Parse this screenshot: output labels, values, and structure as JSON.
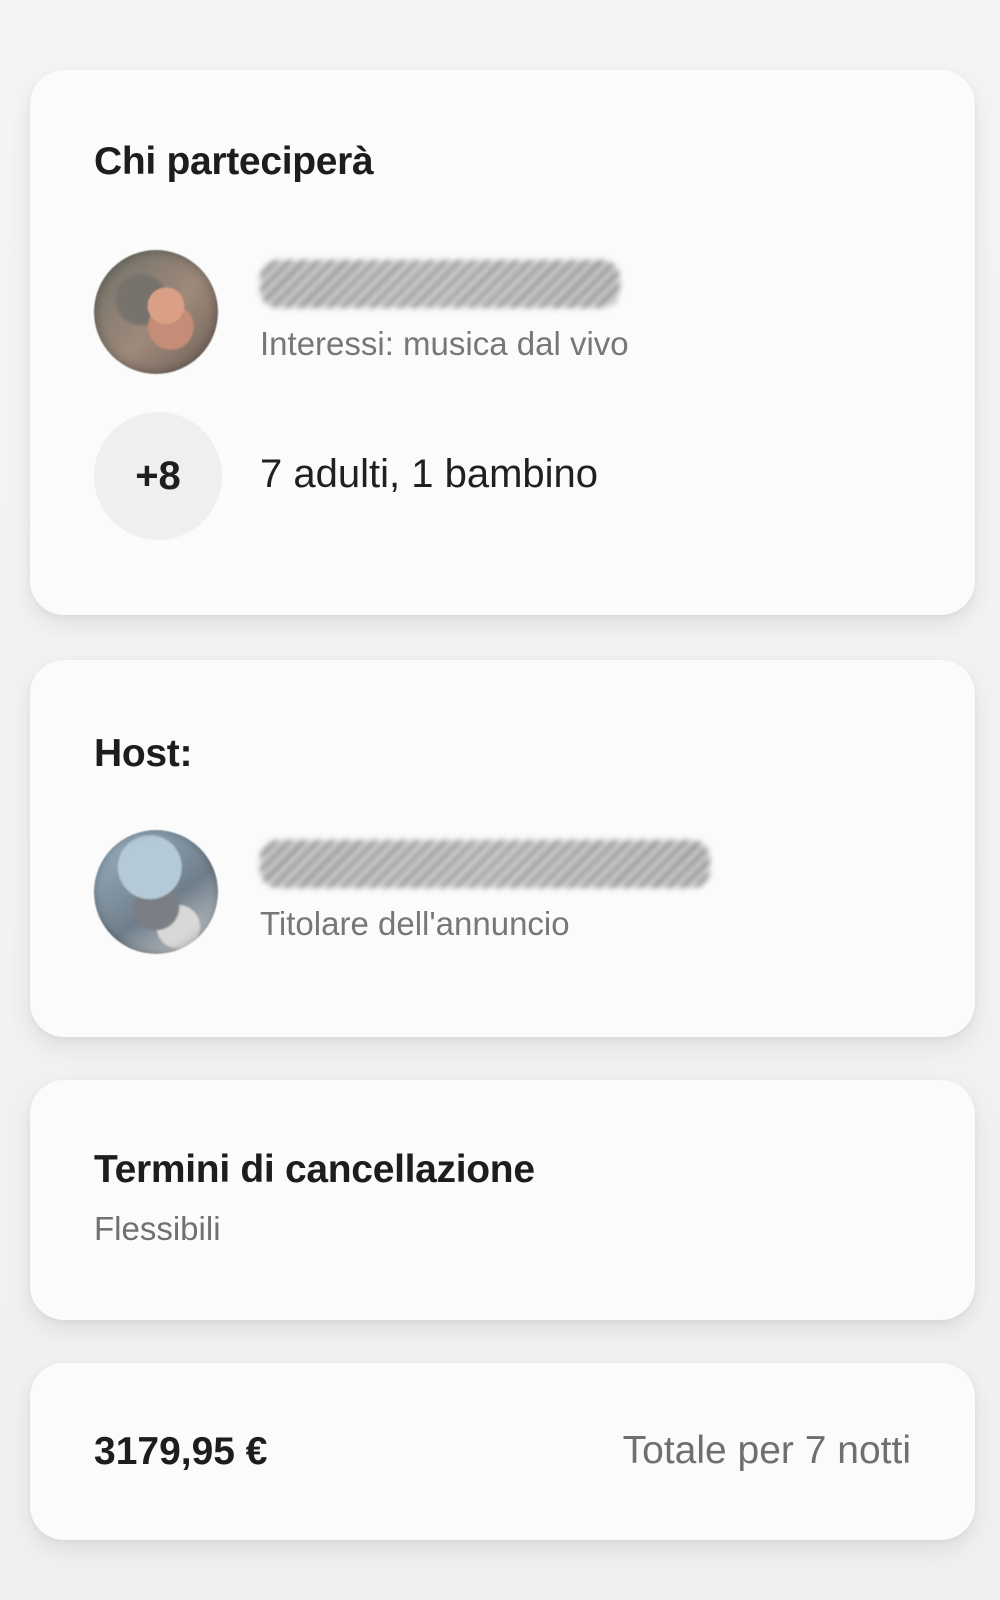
{
  "guests": {
    "title": "Chi parteciperà",
    "guest_interest": "Interessi: musica dal vivo",
    "additional_count": "+8",
    "additional_summary": "7 adulti, 1 bambino"
  },
  "host": {
    "title": "Host:",
    "role": "Titolare dell'annuncio"
  },
  "cancellation": {
    "title": "Termini di cancellazione",
    "value": "Flessibili"
  },
  "total": {
    "price": "3179,95 €",
    "label": "Totale per 7 notti"
  }
}
